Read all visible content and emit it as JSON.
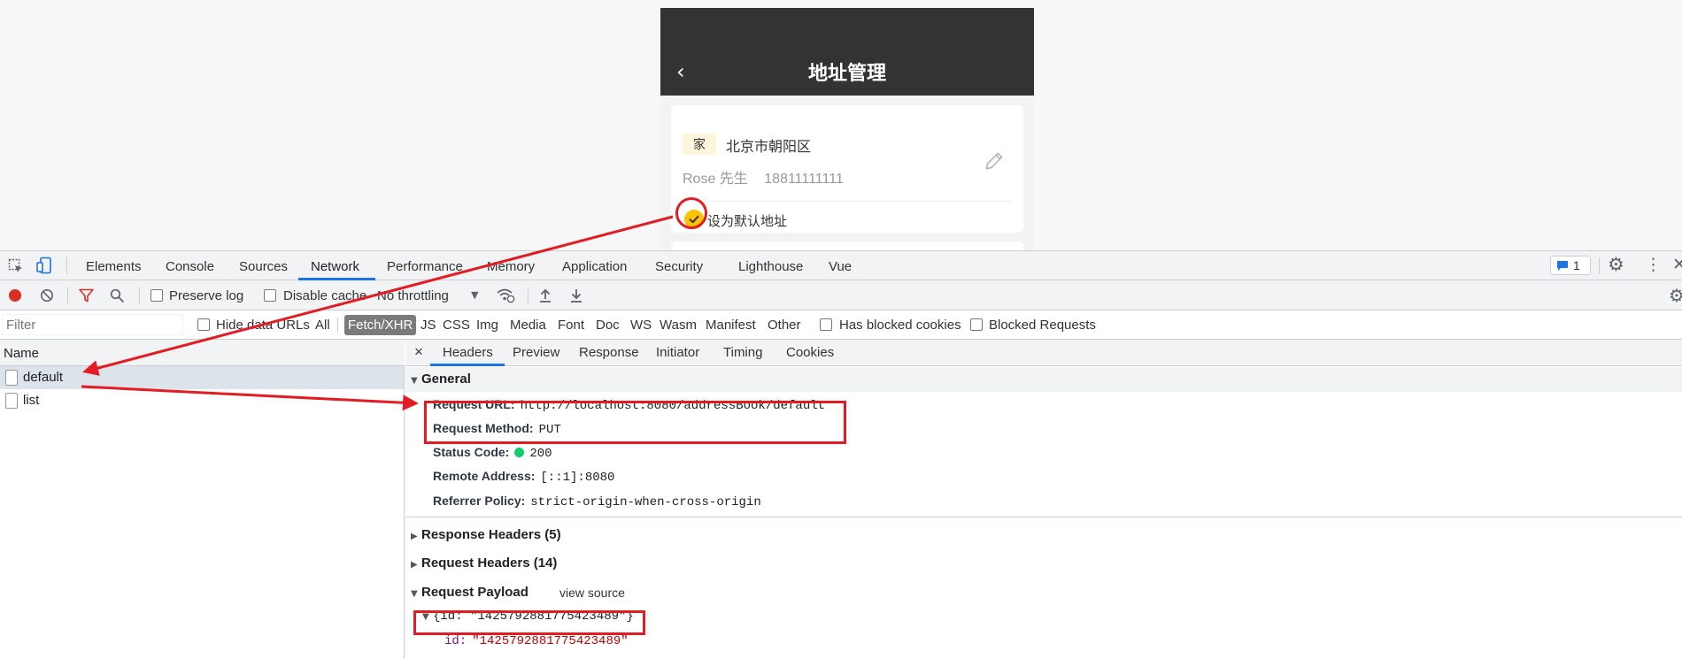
{
  "phone": {
    "back_glyph": "‹",
    "title": "地址管理",
    "address": {
      "tag": "家",
      "text": "北京市朝阳区",
      "name": "Rose 先生",
      "phone": "18811111111",
      "default_label": "设为默认地址"
    },
    "icons": {
      "edit": "pencil-icon",
      "check": "check-icon"
    },
    "accent": "#ffc200"
  },
  "devtools": {
    "tabs": [
      "Elements",
      "Console",
      "Sources",
      "Network",
      "Performance",
      "Memory",
      "Application",
      "Security",
      "Lighthouse",
      "Vue"
    ],
    "active_tab": "Network",
    "issues_count": "1",
    "toolbar": {
      "preserve_log": "Preserve log",
      "disable_cache": "Disable cache",
      "throttling": "No throttling"
    },
    "filter": {
      "placeholder": "Filter",
      "hide_data_urls": "Hide data URLs",
      "types": [
        "All",
        "Fetch/XHR",
        "JS",
        "CSS",
        "Img",
        "Media",
        "Font",
        "Doc",
        "WS",
        "Wasm",
        "Manifest",
        "Other"
      ],
      "active_type": "Fetch/XHR",
      "has_blocked_cookies": "Has blocked cookies",
      "blocked_requests": "Blocked Requests"
    },
    "requests": {
      "header": "Name",
      "items": [
        "default",
        "list"
      ]
    },
    "detail": {
      "close": "×",
      "tabs": [
        "Headers",
        "Preview",
        "Response",
        "Initiator",
        "Timing",
        "Cookies"
      ],
      "general_title": "General",
      "general": [
        {
          "k": "Request URL:",
          "v": "http://localhost:8080/addressBook/default"
        },
        {
          "k": "Request Method:",
          "v": "PUT"
        },
        {
          "k": "Status Code:",
          "v": "200"
        },
        {
          "k": "Remote Address:",
          "v": "[::1]:8080"
        },
        {
          "k": "Referrer Policy:",
          "v": "strict-origin-when-cross-origin"
        }
      ],
      "response_headers": "Response Headers (5)",
      "request_headers": "Request Headers (14)",
      "payload_title": "Request Payload",
      "view_source": "view source",
      "payload_summary": "{id: \"1425792881775423489\"}",
      "payload_key": "id:",
      "payload_value": "\"1425792881775423489\""
    },
    "status_color": "#0cce6b",
    "accent": "#1a73e8"
  },
  "annotation_color": "#e31b23"
}
